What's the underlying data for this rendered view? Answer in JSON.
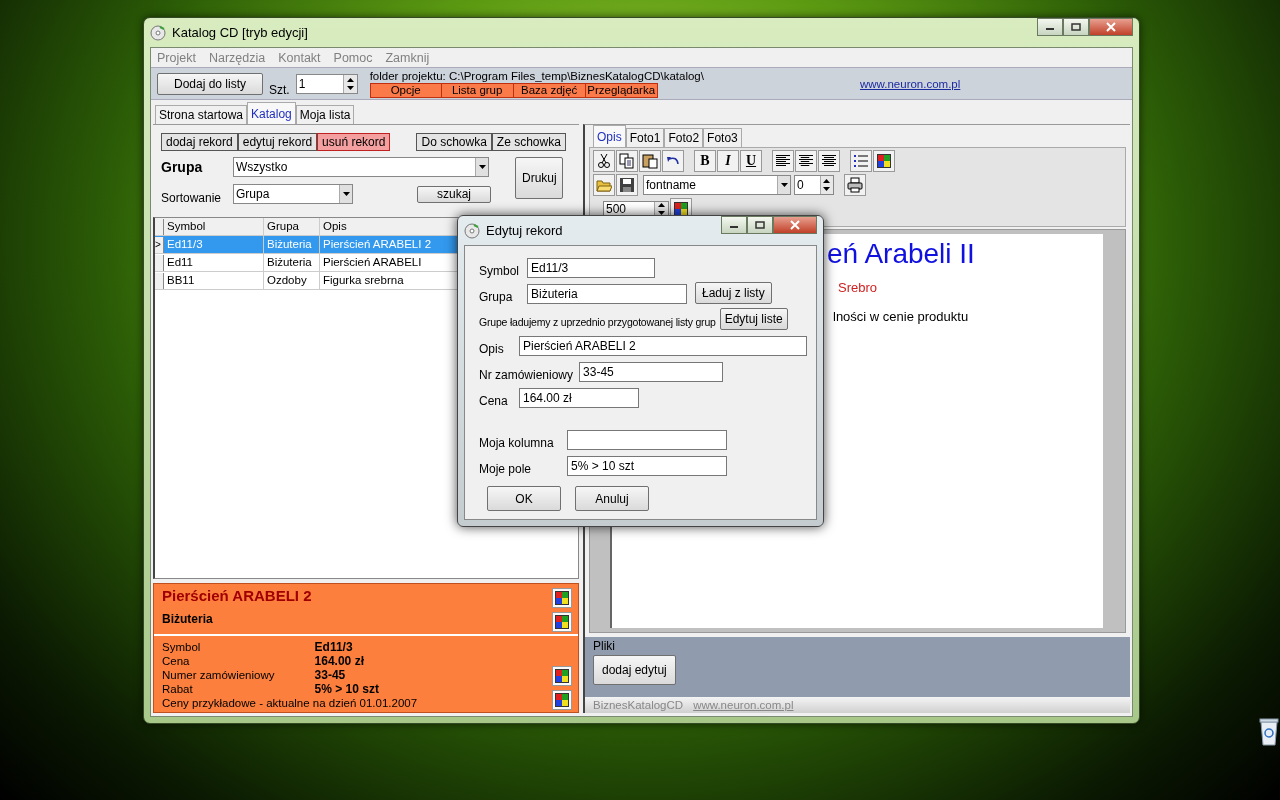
{
  "window": {
    "title": "Katalog CD [tryb edycji]"
  },
  "menu": [
    "Projekt",
    "Narzędzia",
    "Kontakt",
    "Pomoc",
    "Zamknij"
  ],
  "toolbar": {
    "add_button": "Dodaj do listy",
    "qty_label": "Szt.",
    "qty": "1",
    "folder_path": "folder projektu: C:\\Program Files_temp\\BiznesKatalogCD\\katalog\\",
    "actions": [
      "Opcje",
      "Lista grup",
      "Baza zdjęć",
      "Przeglądarka"
    ],
    "link": "www.neuron.com.pl"
  },
  "tabs": [
    {
      "label": "Strona startowa",
      "selected": false
    },
    {
      "label": "Katalog",
      "selected": true
    },
    {
      "label": "Moja lista",
      "selected": false
    }
  ],
  "catalog": {
    "record_buttons": [
      {
        "label": "dodaj rekord",
        "kind": "normal"
      },
      {
        "label": "edytuj rekord",
        "kind": "normal"
      },
      {
        "label": "usuń rekord",
        "kind": "danger"
      }
    ],
    "clipboard_buttons": [
      "Do schowka",
      "Ze schowka"
    ],
    "group_label": "Grupa",
    "group_value": "Wszystko",
    "sort_label": "Sortowanie",
    "sort_value": "Grupa",
    "print_button": "Drukuj",
    "search_button": "szukaj",
    "table": {
      "columns": [
        "Symbol",
        "Grupa",
        "Opis"
      ],
      "rows": [
        {
          "cells": [
            "Ed11/3",
            "Biżuteria",
            "Pierścień ARABELI 2"
          ],
          "selected": true,
          "marker": ">"
        },
        {
          "cells": [
            "Ed11",
            "Biżuteria",
            "Pierścień ARABELI"
          ],
          "selected": false
        },
        {
          "cells": [
            "BB11",
            "Ozdoby",
            "Figurka srebrna"
          ],
          "selected": false
        }
      ]
    },
    "info": {
      "title": "Pierścień ARABELI 2",
      "group": "Biżuteria",
      "fields": [
        {
          "label": "Symbol",
          "value": "Ed11/3"
        },
        {
          "label": "Cena",
          "value": "164.00 zł"
        },
        {
          "label": "Numer zamówieniowy",
          "value": "33-45"
        },
        {
          "label": "Rabat",
          "value": "5% > 10 szt"
        }
      ],
      "note": "Ceny przykładowe - aktualne na dzień 01.01.2007"
    }
  },
  "editor": {
    "tabs": [
      {
        "label": "Opis",
        "selected": true
      },
      {
        "label": "Foto1",
        "selected": false
      },
      {
        "label": "Foto2",
        "selected": false
      },
      {
        "label": "Foto3",
        "selected": false
      }
    ],
    "format_buttons": [
      "B",
      "I",
      "U"
    ],
    "font": "fontname",
    "size": "0",
    "zoom": "500",
    "lines": [
      {
        "text": "eń Arabeli II",
        "kind": "heading"
      },
      {
        "text": "Srebro",
        "kind": "accent"
      },
      {
        "text": "lności w cenie produktu",
        "kind": "body"
      }
    ],
    "files_label": "Pliki",
    "files_button": "dodaj edytuj"
  },
  "status_bar": {
    "app": "BiznesKatalogCD",
    "link": "www.neuron.com.pl"
  },
  "dialog": {
    "title": "Edytuj rekord",
    "rows": [
      {
        "kind": "field",
        "label": "Symbol",
        "value": "Ed11/3"
      },
      {
        "kind": "field_button",
        "label": "Grupa",
        "value": "Biżuteria",
        "button": "Ładuj z listy"
      },
      {
        "kind": "hint_button",
        "label": "Grupe ładujemy z uprzednio przygotowanej listy grup",
        "button": "Edytuj liste"
      },
      {
        "kind": "field",
        "label": "Opis",
        "value": "Pierścień ARABELI 2"
      },
      {
        "kind": "field",
        "label": "Nr zamówieniowy",
        "value": "33-45"
      },
      {
        "kind": "field",
        "label": "Cena",
        "value": "164.00 zł"
      },
      {
        "kind": "field",
        "label": "Moja kolumna",
        "value": ""
      },
      {
        "kind": "field",
        "label": "Moje pole",
        "value": "5% > 10 szt"
      }
    ],
    "buttons": [
      "OK",
      "Anuluj"
    ]
  }
}
